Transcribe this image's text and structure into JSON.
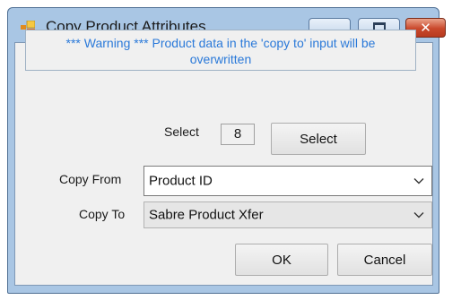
{
  "window": {
    "title": "Copy Product Attributes",
    "controls": {
      "minimize": "minimize",
      "maximize": "maximize",
      "close": "close"
    }
  },
  "warning": {
    "line1": "*** Warning *** Product data in the 'copy to' input will be",
    "line2": "overwritten"
  },
  "select": {
    "label": "Select",
    "count": "8",
    "button_label": "Select"
  },
  "copy_from": {
    "label": "Copy From",
    "value": "Product ID"
  },
  "copy_to": {
    "label": "Copy To",
    "value": "Sabre Product Xfer"
  },
  "buttons": {
    "ok": "OK",
    "cancel": "Cancel"
  },
  "colors": {
    "title_bar": "#a9c6e4",
    "warning_text": "#2a79d9",
    "close_button": "#c9482b",
    "client_bg": "#f0f0f0"
  },
  "icons": {
    "app": "window-app-icon",
    "minimize": "minimize-icon",
    "maximize": "maximize-icon",
    "close": "close-icon",
    "dropdown": "chevron-down-icon"
  }
}
